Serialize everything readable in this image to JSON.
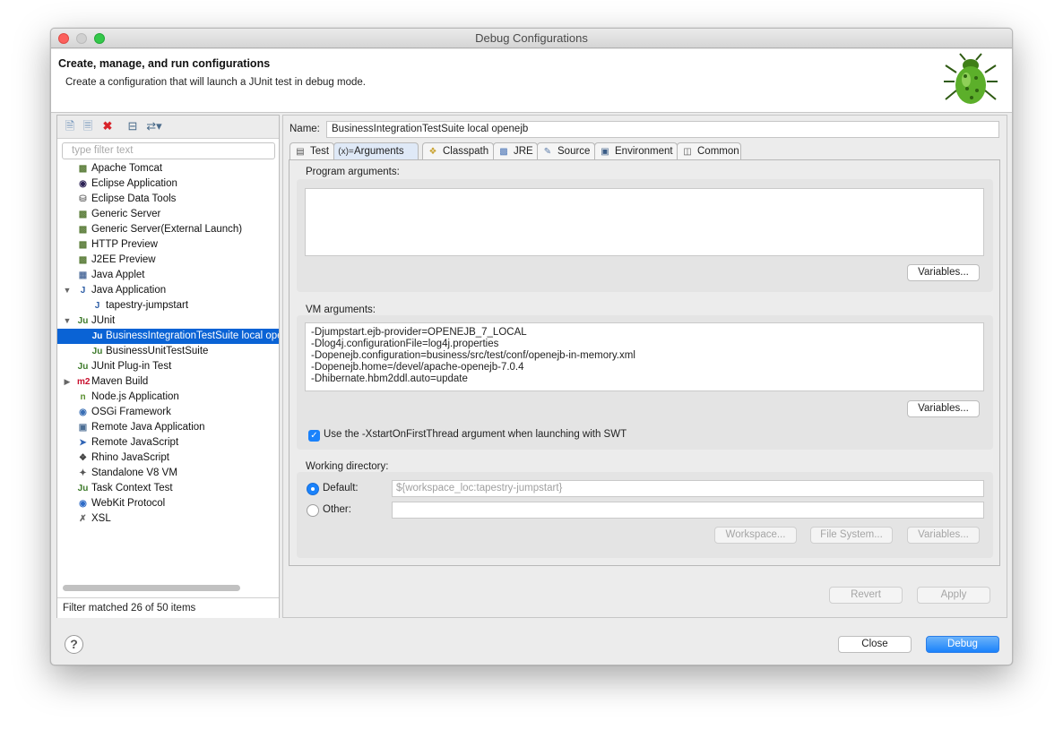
{
  "window": {
    "title": "Debug Configurations"
  },
  "header": {
    "title": "Create, manage, and run configurations",
    "subtitle": "Create a configuration that will launch a JUnit test in debug mode."
  },
  "left": {
    "filter_placeholder": "type filter text",
    "status": "Filter matched 26 of 50 items",
    "tree": [
      {
        "label": "Apache Tomcat",
        "icon": "server-icon",
        "level": 0,
        "twisty": ""
      },
      {
        "label": "Eclipse Application",
        "icon": "eclipse-icon",
        "level": 0,
        "twisty": ""
      },
      {
        "label": "Eclipse Data Tools",
        "icon": "database-icon",
        "level": 0,
        "twisty": ""
      },
      {
        "label": "Generic Server",
        "icon": "server-icon",
        "level": 0,
        "twisty": ""
      },
      {
        "label": "Generic Server(External Launch)",
        "icon": "server-icon",
        "level": 0,
        "twisty": ""
      },
      {
        "label": "HTTP Preview",
        "icon": "server-icon",
        "level": 0,
        "twisty": ""
      },
      {
        "label": "J2EE Preview",
        "icon": "server-icon",
        "level": 0,
        "twisty": ""
      },
      {
        "label": "Java Applet",
        "icon": "applet-icon",
        "level": 0,
        "twisty": ""
      },
      {
        "label": "Java Application",
        "icon": "java-app-icon",
        "level": 0,
        "twisty": "expanded"
      },
      {
        "label": "tapestry-jumpstart",
        "icon": "java-app-icon",
        "level": 1,
        "twisty": ""
      },
      {
        "label": "JUnit",
        "icon": "junit-icon",
        "level": 0,
        "twisty": "expanded"
      },
      {
        "label": "BusinessIntegrationTestSuite local openejb",
        "icon": "junit-icon",
        "level": 1,
        "twisty": "",
        "selected": true
      },
      {
        "label": "BusinessUnitTestSuite",
        "icon": "junit-icon",
        "level": 1,
        "twisty": ""
      },
      {
        "label": "JUnit Plug-in Test",
        "icon": "junit-plugin-icon",
        "level": 0,
        "twisty": ""
      },
      {
        "label": "Maven Build",
        "icon": "maven-icon",
        "level": 0,
        "twisty": "collapsed"
      },
      {
        "label": "Node.js Application",
        "icon": "nodejs-icon",
        "level": 0,
        "twisty": ""
      },
      {
        "label": "OSGi Framework",
        "icon": "osgi-icon",
        "level": 0,
        "twisty": ""
      },
      {
        "label": "Remote Java Application",
        "icon": "remote-java-icon",
        "level": 0,
        "twisty": ""
      },
      {
        "label": "Remote JavaScript",
        "icon": "remote-js-icon",
        "level": 0,
        "twisty": ""
      },
      {
        "label": "Rhino JavaScript",
        "icon": "rhino-icon",
        "level": 0,
        "twisty": ""
      },
      {
        "label": "Standalone V8 VM",
        "icon": "v8-icon",
        "level": 0,
        "twisty": ""
      },
      {
        "label": "Task Context Test",
        "icon": "junit-icon",
        "level": 0,
        "twisty": ""
      },
      {
        "label": "WebKit Protocol",
        "icon": "webkit-icon",
        "level": 0,
        "twisty": ""
      },
      {
        "label": "XSL",
        "icon": "xsl-icon",
        "level": 0,
        "twisty": ""
      }
    ]
  },
  "right": {
    "name_label": "Name:",
    "name_value": "BusinessIntegrationTestSuite local openejb",
    "tabs": [
      {
        "label": "Test",
        "icon": "test-tab-icon"
      },
      {
        "label": "Arguments",
        "icon": "arguments-tab-icon",
        "active": true
      },
      {
        "label": "Classpath",
        "icon": "classpath-tab-icon"
      },
      {
        "label": "JRE",
        "icon": "jre-tab-icon"
      },
      {
        "label": "Source",
        "icon": "source-tab-icon"
      },
      {
        "label": "Environment",
        "icon": "environment-tab-icon"
      },
      {
        "label": "Common",
        "icon": "common-tab-icon"
      }
    ],
    "program_args": {
      "label": "Program arguments:",
      "value": "",
      "variables": "Variables..."
    },
    "vm_args": {
      "label": "VM arguments:",
      "value": "-Djumpstart.ejb-provider=OPENEJB_7_LOCAL\n-Dlog4j.configurationFile=log4j.properties\n-Dopenejb.configuration=business/src/test/conf/openejb-in-memory.xml\n-Dopenejb.home=/devel/apache-openejb-7.0.4\n-Dhibernate.hbm2ddl.auto=update",
      "variables": "Variables..."
    },
    "xstart": {
      "label": "Use the -XstartOnFirstThread argument when launching with SWT",
      "checked": true
    },
    "working_dir": {
      "label": "Working directory:",
      "default_label": "Default:",
      "default_value": "${workspace_loc:tapestry-jumpstart}",
      "other_label": "Other:",
      "other_value": "",
      "workspace_btn": "Workspace...",
      "filesystem_btn": "File System...",
      "variables_btn": "Variables..."
    },
    "revert": "Revert",
    "apply": "Apply"
  },
  "footer": {
    "help": "?",
    "close": "Close",
    "debug": "Debug"
  },
  "colors": {
    "accent": "#1a82fb",
    "selection": "#0a63d5"
  }
}
